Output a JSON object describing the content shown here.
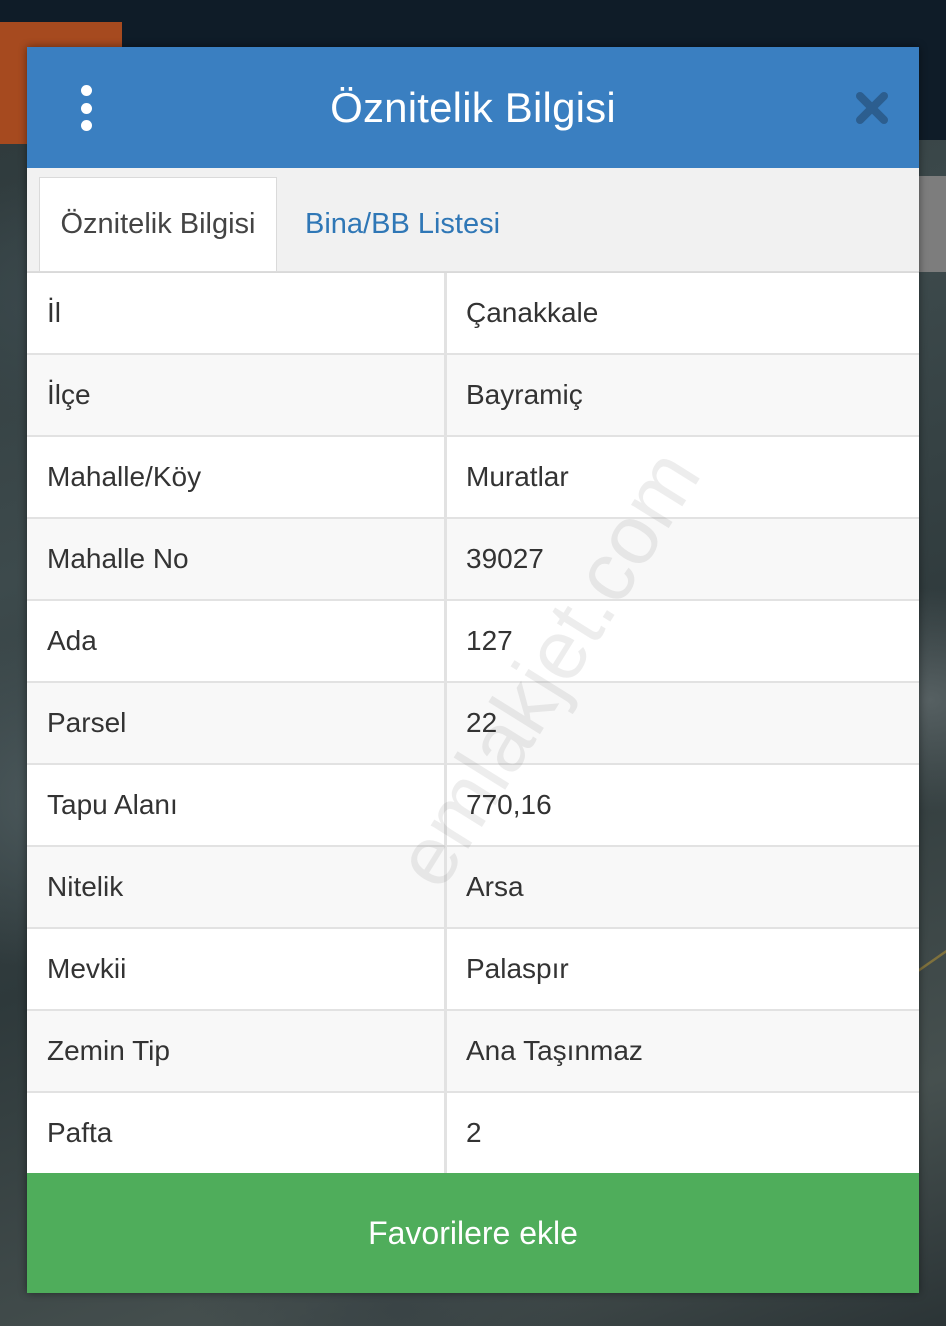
{
  "dialog": {
    "title": "Öznitelik Bilgisi",
    "menu_icon": "vertical-ellipsis-icon",
    "close_icon": "close-icon"
  },
  "tabs": [
    {
      "label": "Öznitelik Bilgisi",
      "active": true
    },
    {
      "label": "Bina/BB Listesi",
      "active": false
    }
  ],
  "attributes": [
    {
      "key": "İl",
      "value": "Çanakkale"
    },
    {
      "key": "İlçe",
      "value": "Bayramiç"
    },
    {
      "key": "Mahalle/Köy",
      "value": "Muratlar"
    },
    {
      "key": "Mahalle No",
      "value": "39027"
    },
    {
      "key": "Ada",
      "value": "127"
    },
    {
      "key": "Parsel",
      "value": "22"
    },
    {
      "key": "Tapu Alanı",
      "value": "770,16"
    },
    {
      "key": "Nitelik",
      "value": "Arsa"
    },
    {
      "key": "Mevkii",
      "value": "Palaspır"
    },
    {
      "key": "Zemin Tip",
      "value": "Ana Taşınmaz"
    },
    {
      "key": "Pafta",
      "value": "2"
    }
  ],
  "footer": {
    "favorite_label": "Favorilere ekle"
  },
  "watermark": "emlakjet.com",
  "colors": {
    "header": "#3a7fc1",
    "close_icon": "#2c5e8f",
    "tab_link": "#2f77b6",
    "favorite_button": "#4fad5b"
  }
}
